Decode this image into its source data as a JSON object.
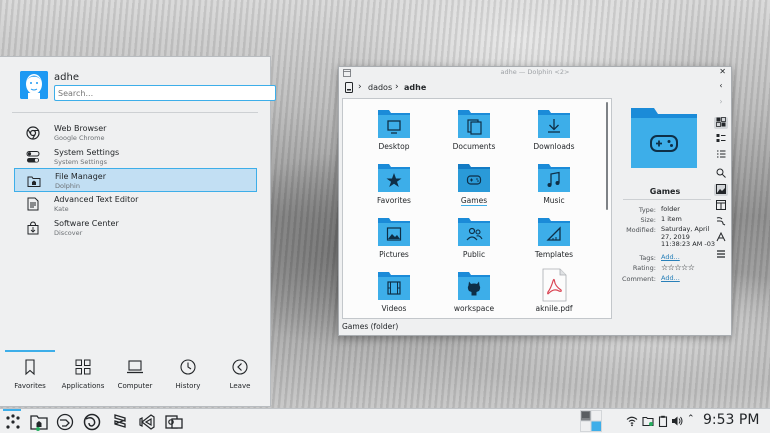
{
  "launcher": {
    "username": "adhe",
    "search_placeholder": "Search...",
    "favorites": [
      {
        "name": "Web Browser",
        "desc": "Google Chrome",
        "icon": "chrome-icon"
      },
      {
        "name": "System Settings",
        "desc": "System Settings",
        "icon": "settings-toggle-icon"
      },
      {
        "name": "File Manager",
        "desc": "Dolphin",
        "icon": "home-folder-icon"
      },
      {
        "name": "Advanced Text Editor",
        "desc": "Kate",
        "icon": "text-editor-icon"
      },
      {
        "name": "Software Center",
        "desc": "Discover",
        "icon": "shopping-bag-icon"
      }
    ],
    "tabs": [
      {
        "label": "Favorites",
        "icon": "bookmark-icon"
      },
      {
        "label": "Applications",
        "icon": "grid-icon"
      },
      {
        "label": "Computer",
        "icon": "laptop-icon"
      },
      {
        "label": "History",
        "icon": "clock-icon"
      },
      {
        "label": "Leave",
        "icon": "leave-arrow-icon"
      }
    ]
  },
  "dolphin": {
    "title": "adhe — Dolphin <2>",
    "breadcrumbs": [
      "dados",
      "adhe"
    ],
    "items": [
      {
        "name": "Desktop",
        "icon": "desktop-folder-icon"
      },
      {
        "name": "Documents",
        "icon": "documents-folder-icon"
      },
      {
        "name": "Downloads",
        "icon": "downloads-folder-icon"
      },
      {
        "name": "Favorites",
        "icon": "star-folder-icon"
      },
      {
        "name": "Games",
        "icon": "games-folder-icon"
      },
      {
        "name": "Music",
        "icon": "music-folder-icon"
      },
      {
        "name": "Pictures",
        "icon": "pictures-folder-icon"
      },
      {
        "name": "Public",
        "icon": "public-folder-icon"
      },
      {
        "name": "Templates",
        "icon": "templates-folder-icon"
      },
      {
        "name": "Videos",
        "icon": "videos-folder-icon"
      },
      {
        "name": "workspace",
        "icon": "github-folder-icon"
      },
      {
        "name": "aknile.pdf",
        "icon": "pdf-file-icon"
      }
    ],
    "status": "Games (folder)",
    "info": {
      "title": "Games",
      "type_label": "Type:",
      "type_value": "folder",
      "size_label": "Size:",
      "size_value": "1 item",
      "modified_label": "Modified:",
      "modified_value": "Saturday, April 27, 2019 11:38:23 AM -03",
      "tags_label": "Tags:",
      "tags_value": "Add...",
      "rating_label": "Rating:",
      "rating_value": "☆☆☆☆☆",
      "comment_label": "Comment:",
      "comment_value": "Add..."
    }
  },
  "panel": {
    "clock": "9:53 PM"
  },
  "colors": {
    "accent": "#3daee9",
    "folder": "#1d99f3"
  }
}
